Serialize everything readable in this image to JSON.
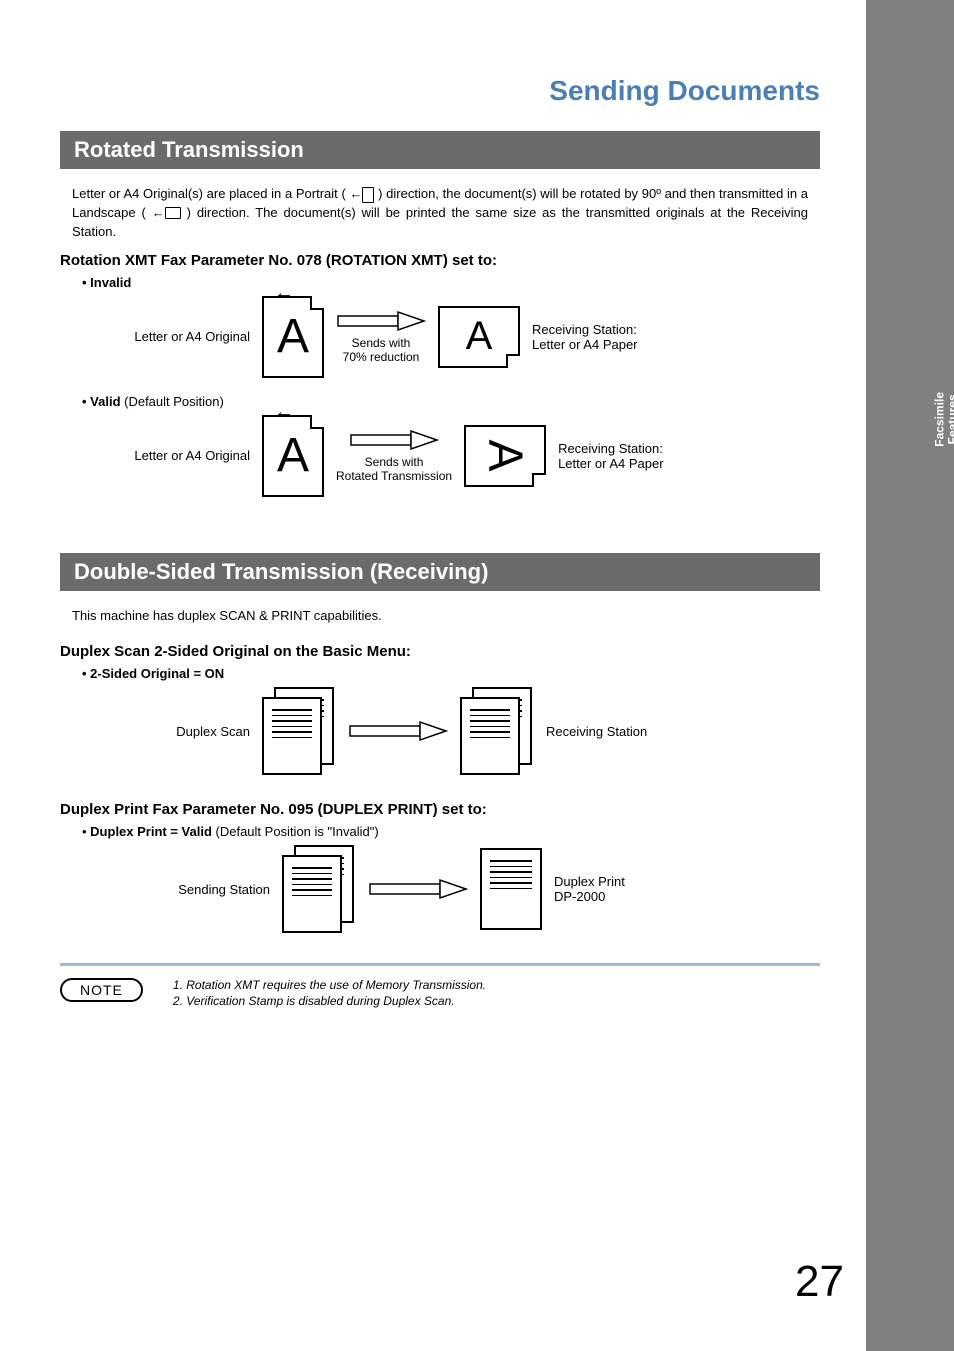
{
  "sideTab": "Facsimile\nFeatures",
  "pageTitle": "Sending Documents",
  "section1": {
    "header": "Rotated Transmission",
    "para": "Letter or A4 Original(s) are placed in a Portrait ( ← [P] ) direction, the document(s) will be rotated by 90º and then transmitted in a Landscape ( ← [L] ) direction. The document(s) will be printed the same size as the transmitted originals at the Receiving Station.",
    "subhead": "Rotation XMT Fax Parameter No. 078 (ROTATION XMT) set to:",
    "invalid": "• Invalid",
    "valid1": "• Valid ",
    "valid2": "(Default Position)",
    "leftLabel": "Letter or A4 Original",
    "sendReduce": "Sends with\n70% reduction",
    "sendRotated": "Sends with\nRotated Transmission",
    "rightLabel": "Receiving Station:\nLetter or A4 Paper"
  },
  "section2": {
    "header": "Double-Sided Transmission (Receiving)",
    "para": "This machine has duplex SCAN & PRINT capabilities.",
    "subhead1": "Duplex Scan 2-Sided Original on the Basic Menu:",
    "bullet1": "• 2-Sided Original = ON",
    "leftLabel1": "Duplex Scan",
    "rightLabel1": "Receiving Station",
    "subhead2": "Duplex Print Fax Parameter No. 095 (DUPLEX PRINT) set to:",
    "bullet2a": "• ",
    "bullet2b": "Duplex Print = Valid",
    "bullet2c": " (Default Position is \"Invalid\")",
    "leftLabel2": "Sending Station",
    "rightLabel2": "Duplex Print\nDP-2000"
  },
  "note": {
    "badge": "NOTE",
    "item1": "1. Rotation XMT requires the use of Memory Transmission.",
    "item2": "2. Verification Stamp is disabled during Duplex Scan."
  },
  "pageNumber": "27"
}
